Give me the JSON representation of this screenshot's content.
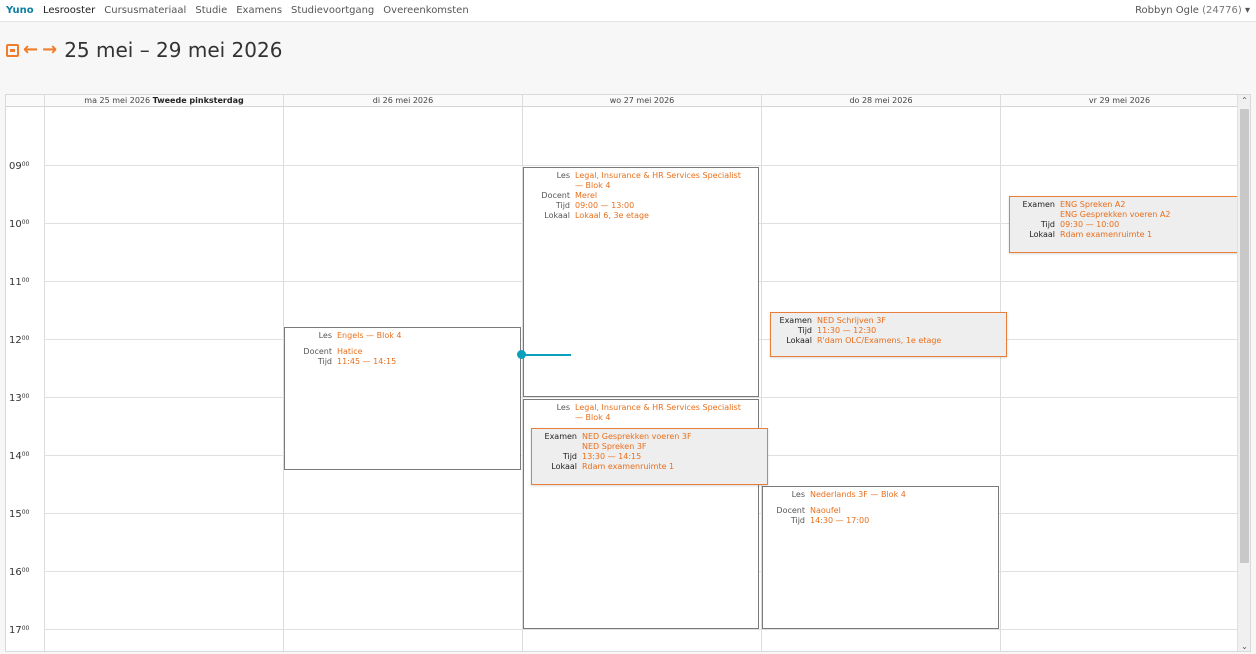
{
  "topbar": {
    "brand": "Yuno",
    "nav": [
      "Lesrooster",
      "Cursusmateriaal",
      "Studie",
      "Examens",
      "Studievoortgang",
      "Overeenkomsten"
    ],
    "user_name": "Robbyn Ogle",
    "user_id": "(24776)",
    "user_caret": "▾"
  },
  "week": {
    "title": "25 mei – 29 mei 2026"
  },
  "days": {
    "mon_date": "ma 25 mei 2026",
    "mon_note": "Tweede pinksterdag",
    "tue": "di 26 mei 2026",
    "wed": "wo 27 mei 2026",
    "thu": "do 28 mei 2026",
    "fri": "vr 29 mei 2026"
  },
  "hours": [
    {
      "h": "09",
      "m": "00"
    },
    {
      "h": "10",
      "m": "00"
    },
    {
      "h": "11",
      "m": "00"
    },
    {
      "h": "12",
      "m": "00"
    },
    {
      "h": "13",
      "m": "00"
    },
    {
      "h": "14",
      "m": "00"
    },
    {
      "h": "15",
      "m": "00"
    },
    {
      "h": "16",
      "m": "00"
    },
    {
      "h": "17",
      "m": "00"
    }
  ],
  "labels": {
    "les": "Les",
    "docent": "Docent",
    "tijd": "Tijd",
    "lokaal": "Lokaal",
    "examen": "Examen"
  },
  "events": {
    "wed1": {
      "les": "Legal, Insurance & HR Services Specialist — Blok 4",
      "docent": "Merel",
      "tijd": "09:00 — 13:00",
      "lokaal": "Lokaal 6, 3e etage"
    },
    "tue1": {
      "les": "Engels — Blok 4",
      "docent": "Hatice",
      "tijd": "11:45 — 14:15"
    },
    "wed2": {
      "les": "Legal, Insurance & HR Services Specialist — Blok 4"
    },
    "thu1": {
      "les": "Nederlands 3F — Blok 4",
      "docent": "Naoufel",
      "tijd": "14:30 — 17:00"
    }
  },
  "exams": {
    "fri": {
      "examen1": "ENG Spreken A2",
      "examen2": "ENG Gesprekken voeren A2",
      "tijd": "09:30 — 10:00",
      "lokaal": "Rdam examenruimte 1"
    },
    "thu": {
      "examen1": "NED Schrijven 3F",
      "tijd": "11:30 — 12:30",
      "lokaal": "R'dam OLC/Examens, 1e etage"
    },
    "wed": {
      "examen1": "NED Gesprekken voeren 3F",
      "examen2": "NED Spreken 3F",
      "tijd": "13:30 — 14:15",
      "lokaal": "Rdam examenruimte 1"
    }
  },
  "colors": {
    "accent": "#e86f1c",
    "brand": "#0d7fa3",
    "now": "#0aa0bd"
  }
}
